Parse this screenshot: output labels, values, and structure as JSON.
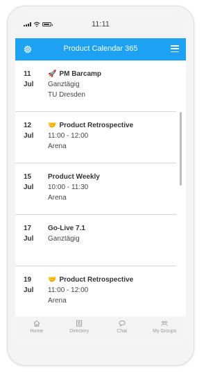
{
  "status_bar": {
    "time": "11:11"
  },
  "header": {
    "title": "Product Calendar 365",
    "settings_icon": "gear-icon",
    "menu_icon": "hamburger-menu-icon",
    "color": "#1da1f2"
  },
  "events": [
    {
      "day": "11",
      "month": "Jul",
      "icon": "🚀",
      "title": "PM Barcamp",
      "time": "Ganztägig",
      "location": "TU Dresden"
    },
    {
      "day": "12",
      "month": "Jul",
      "icon": "🤝",
      "title": "Product Retrospective",
      "time": "11:00 - 12:00",
      "location": "Arena"
    },
    {
      "day": "15",
      "month": "Jul",
      "icon": "",
      "title": "Product Weekly",
      "time": "10:00 - 11:30",
      "location": "Arena"
    },
    {
      "day": "17",
      "month": "Jul",
      "icon": "",
      "title": "Go-Live 7.1",
      "time": "Ganztägig",
      "location": ""
    },
    {
      "day": "19",
      "month": "Jul",
      "icon": "🤝",
      "title": "Product Retrospective",
      "time": "11:00 - 12:00",
      "location": "Arena"
    }
  ],
  "bottom_nav": [
    {
      "label": "Home",
      "icon": "home-icon"
    },
    {
      "label": "Directory",
      "icon": "directory-icon"
    },
    {
      "label": "Chat",
      "icon": "chat-icon"
    },
    {
      "label": "My Groups",
      "icon": "groups-icon"
    }
  ]
}
